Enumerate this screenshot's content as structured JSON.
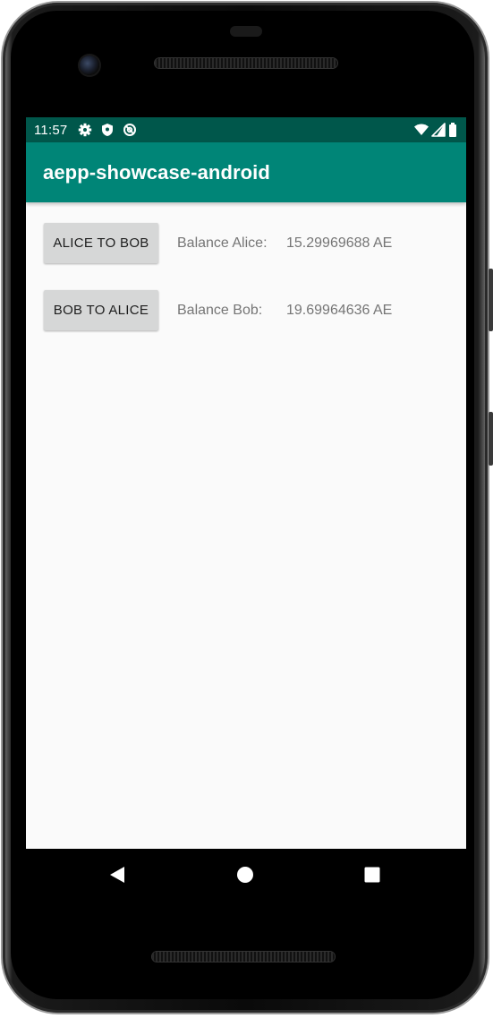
{
  "status_bar": {
    "time": "11:57",
    "left_icons": [
      "settings-icon",
      "shield-icon",
      "sync-disabled-icon"
    ],
    "right_icons": [
      "wifi-icon",
      "cell-signal-icon",
      "battery-icon"
    ],
    "background": "#00574b"
  },
  "app_bar": {
    "title": "aepp-showcase-android",
    "background": "#008577"
  },
  "transfers": [
    {
      "button_label": "ALICE TO BOB",
      "balance_label": "Balance Alice:",
      "balance_value": "15.29969688 AE"
    },
    {
      "button_label": "BOB TO ALICE",
      "balance_label": "Balance Bob:",
      "balance_value": "19.69964636 AE"
    }
  ],
  "nav_bar": {
    "buttons": [
      "back-icon",
      "home-icon",
      "recents-icon"
    ]
  },
  "colors": {
    "screen_background": "#fafafa",
    "button_background": "#d6d7d7",
    "secondary_text": "#757575"
  }
}
